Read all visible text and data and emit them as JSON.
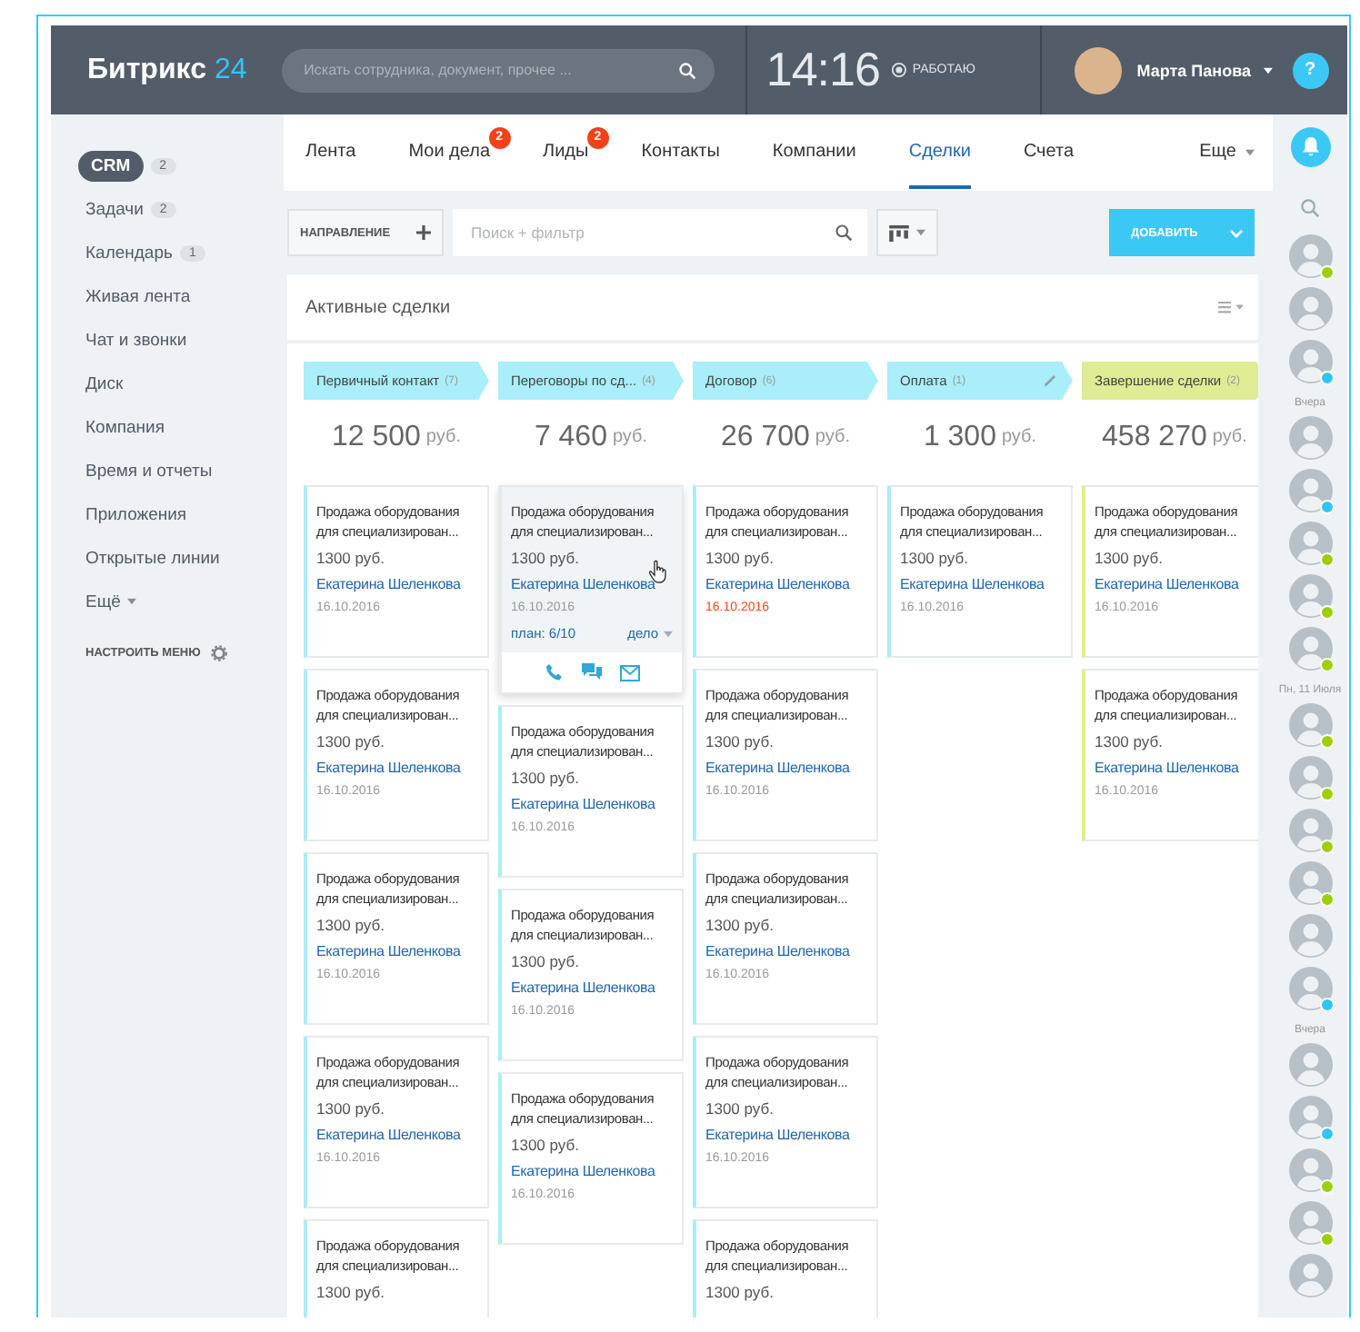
{
  "header": {
    "logo_text": "Битрикс",
    "logo_number": "24",
    "search": {
      "placeholder": "Искать сотрудника, документ, прочее ..."
    },
    "time": "14:16",
    "work_status": "РАБОТАЮ",
    "user_name": "Марта Панова"
  },
  "sidebar": {
    "items": [
      {
        "label": "CRM",
        "count": "2",
        "selected": true
      },
      {
        "label": "Задачи",
        "count": "2",
        "selected": false
      },
      {
        "label": "Календарь",
        "count": "1",
        "selected": false
      },
      {
        "label": "Живая лента",
        "selected": false
      },
      {
        "label": "Чат и звонки",
        "selected": false
      },
      {
        "label": "Диск",
        "selected": false
      },
      {
        "label": "Компания",
        "selected": false
      },
      {
        "label": "Время и отчеты",
        "selected": false
      },
      {
        "label": "Приложения",
        "selected": false
      },
      {
        "label": "Открытые линии",
        "selected": false
      },
      {
        "label": "Ещё",
        "selected": false,
        "dropdown": true
      }
    ],
    "configure": "НАСТРОИТЬ МЕНЮ"
  },
  "tabs": [
    {
      "label": "Лента",
      "selected": false
    },
    {
      "label": "Мои дела",
      "badge": "2",
      "selected": false
    },
    {
      "label": "Лиды",
      "badge": "2",
      "selected": false
    },
    {
      "label": "Контакты",
      "selected": false
    },
    {
      "label": "Компании",
      "selected": false
    },
    {
      "label": "Сделки",
      "selected": true
    },
    {
      "label": "Счета",
      "selected": false
    }
  ],
  "more_tab": "Еще",
  "toolbar": {
    "direction_button": "НАПРАВЛЕНИЕ",
    "filter": {
      "placeholder": "Поиск + фильтр"
    },
    "add_button": "ДОБАВИТЬ"
  },
  "board": {
    "title": "Активные сделки",
    "columns": [
      {
        "name": "Первичный контакт",
        "count": "(7)",
        "color": "#a9eef8",
        "editable": false,
        "total": "12 500",
        "currency": "руб.",
        "cards": [
          {
            "title": "Продажа оборудования для специализирован...",
            "price": "1300 руб.",
            "person": "Екатерина Шеленкова",
            "date": "16.10.2016",
            "overdue": false,
            "hovered": false
          },
          {
            "title": "Продажа оборудования для специализирован...",
            "price": "1300 руб.",
            "person": "Екатерина Шеленкова",
            "date": "16.10.2016",
            "overdue": false,
            "hovered": false
          },
          {
            "title": "Продажа оборудования для специализирован...",
            "price": "1300 руб.",
            "person": "Екатерина Шеленкова",
            "date": "16.10.2016",
            "overdue": false,
            "hovered": false
          },
          {
            "title": "Продажа оборудования для специализирован...",
            "price": "1300 руб.",
            "person": "Екатерина Шеленкова",
            "date": "16.10.2016",
            "overdue": false,
            "hovered": false
          },
          {
            "title": "Продажа оборудования для специализирован...",
            "price": "1300 руб.",
            "hovered": false
          }
        ]
      },
      {
        "name": "Переговоры по сд...",
        "count": "(4)",
        "color": "#a9eef8",
        "editable": false,
        "total": "7 460",
        "currency": "руб.",
        "cards": [
          {
            "title": "Продажа оборудования для специализирован...",
            "price": "1300 руб.",
            "person": "Екатерина Шеленкова",
            "date": "16.10.2016",
            "overdue": false,
            "hovered": true,
            "plan": "план: 6/10",
            "action": "дело"
          },
          {
            "title": "Продажа оборудования для специализирован...",
            "price": "1300 руб.",
            "person": "Екатерина Шеленкова",
            "date": "16.10.2016",
            "overdue": false,
            "hovered": false
          },
          {
            "title": "Продажа оборудования для специализирован...",
            "price": "1300 руб.",
            "person": "Екатерина Шеленкова",
            "date": "16.10.2016",
            "overdue": false,
            "hovered": false
          },
          {
            "title": "Продажа оборудования для специализирован...",
            "price": "1300 руб.",
            "person": "Екатерина Шеленкова",
            "date": "16.10.2016",
            "overdue": false,
            "hovered": false
          }
        ]
      },
      {
        "name": "Договор",
        "count": "(6)",
        "color": "#a9eef8",
        "editable": false,
        "total": "26 700",
        "currency": "руб.",
        "cards": [
          {
            "title": "Продажа оборудования для специализирован...",
            "price": "1300 руб.",
            "person": "Екатерина Шеленкова",
            "date": "16.10.2016",
            "overdue": true,
            "hovered": false
          },
          {
            "title": "Продажа оборудования для специализирован...",
            "price": "1300 руб.",
            "person": "Екатерина Шеленкова",
            "date": "16.10.2016",
            "overdue": false,
            "hovered": false
          },
          {
            "title": "Продажа оборудования для специализирован...",
            "price": "1300 руб.",
            "person": "Екатерина Шеленкова",
            "date": "16.10.2016",
            "overdue": false,
            "hovered": false
          },
          {
            "title": "Продажа оборудования для специализирован...",
            "price": "1300 руб.",
            "person": "Екатерина Шеленкова",
            "date": "16.10.2016",
            "overdue": false,
            "hovered": false
          },
          {
            "title": "Продажа оборудования для специализирован...",
            "price": "1300 руб.",
            "hovered": false
          }
        ]
      },
      {
        "name": "Оплата",
        "count": "(1)",
        "color": "#a9eef8",
        "editable": true,
        "total": "1 300",
        "currency": "руб.",
        "cards": [
          {
            "title": "Продажа оборудования для специализирован...",
            "price": "1300 руб.",
            "person": "Екатерина Шеленкова",
            "date": "16.10.2016",
            "overdue": false,
            "hovered": false
          }
        ]
      },
      {
        "name": "Завершение сделки",
        "count": "(2)",
        "color": "#dfec94",
        "editable": false,
        "total": "458 270",
        "currency": "руб.",
        "cards": [
          {
            "title": "Продажа оборудования для специализирован...",
            "price": "1300 руб.",
            "person": "Екатерина Шеленкова",
            "date": "16.10.2016",
            "overdue": false,
            "hovered": false
          },
          {
            "title": "Продажа оборудования для специализирован...",
            "price": "1300 руб.",
            "person": "Екатерина Шеленкова",
            "date": "16.10.2016",
            "overdue": false,
            "hovered": false
          }
        ]
      }
    ]
  },
  "right_panel": {
    "help": "?",
    "groups": [
      {
        "avatars": [
          {
            "status_dot": true,
            "color": "#9dcf00"
          },
          {
            "status_dot": false
          },
          {
            "status_dot": true,
            "color": "#2fc6f6"
          }
        ]
      },
      {
        "label": "Вчера",
        "avatars": [
          {
            "status_dot": false
          },
          {
            "status_dot": true,
            "color": "#2fc6f6"
          },
          {
            "status_dot": true,
            "color": "#9dcf00"
          },
          {
            "status_dot": true,
            "color": "#9dcf00"
          },
          {
            "status_dot": true,
            "color": "#9dcf00"
          }
        ]
      },
      {
        "label": "Пн, 11 Июля",
        "avatars": [
          {
            "status_dot": true,
            "color": "#9dcf00"
          },
          {
            "status_dot": true,
            "color": "#9dcf00"
          },
          {
            "status_dot": true,
            "color": "#9dcf00"
          },
          {
            "status_dot": true,
            "color": "#9dcf00"
          },
          {
            "status_dot": false
          },
          {
            "status_dot": true,
            "color": "#2fc6f6"
          }
        ]
      },
      {
        "label": "Вчера",
        "avatars": [
          {
            "status_dot": false
          },
          {
            "status_dot": true,
            "color": "#2fc6f6"
          },
          {
            "status_dot": true,
            "color": "#9dcf00"
          },
          {
            "status_dot": true,
            "color": "#9dcf00"
          },
          {
            "status_dot": false
          }
        ]
      }
    ]
  }
}
